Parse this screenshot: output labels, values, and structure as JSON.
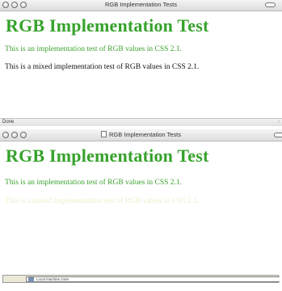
{
  "window1": {
    "title": "RGB Implementation Tests",
    "heading": "RGB Implementation Test",
    "line1": "This is an implementation test of RGB values in CSS 2.1.",
    "line2": "This is a mixed implementation test of RGB values in CSS 2.1.",
    "status": "Done"
  },
  "window2": {
    "title": "RGB Implementation Tests",
    "heading": "RGB Implementation Test",
    "line1": "This is an implementation test of RGB values in CSS 2.1.",
    "line2": "This is a mixed implementation test of RGB values in CSS 2.1."
  },
  "ie_status": {
    "zone": "Local machine zone"
  },
  "colors": {
    "heading_green": "#36a22b",
    "text_green": "#3aa32e",
    "faded_green": "#e6f2c8"
  }
}
